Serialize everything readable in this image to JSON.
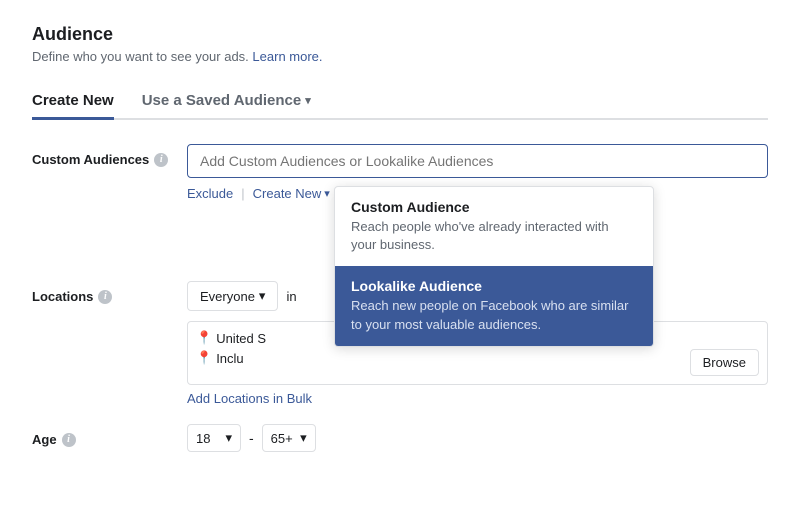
{
  "page": {
    "section_title": "Audience",
    "section_subtitle": "Define who you want to see your ads.",
    "learn_more_link": "Learn more."
  },
  "tabs": {
    "create_new": "Create New",
    "use_saved": "Use a Saved Audience",
    "active": "create_new"
  },
  "custom_audiences": {
    "label": "Custom Audiences",
    "placeholder": "Add Custom Audiences or Lookalike Audiences",
    "exclude_label": "Exclude",
    "create_new_label": "Create New"
  },
  "dropdown": {
    "items": [
      {
        "id": "custom_audience",
        "title": "Custom Audience",
        "description": "Reach people who've already interacted with your business.",
        "highlighted": false
      },
      {
        "id": "lookalike_audience",
        "title": "Lookalike Audience",
        "description": "Reach new people on Facebook who are similar to your most valuable audiences.",
        "highlighted": true
      }
    ]
  },
  "locations": {
    "label": "Locations",
    "everyone_label": "Everyone",
    "united_states_label": "United States",
    "include_label": "Include",
    "browse_label": "Browse",
    "add_locations_label": "Add Locations in Bulk"
  },
  "age": {
    "label": "Age",
    "from": "18",
    "to": "65+"
  }
}
